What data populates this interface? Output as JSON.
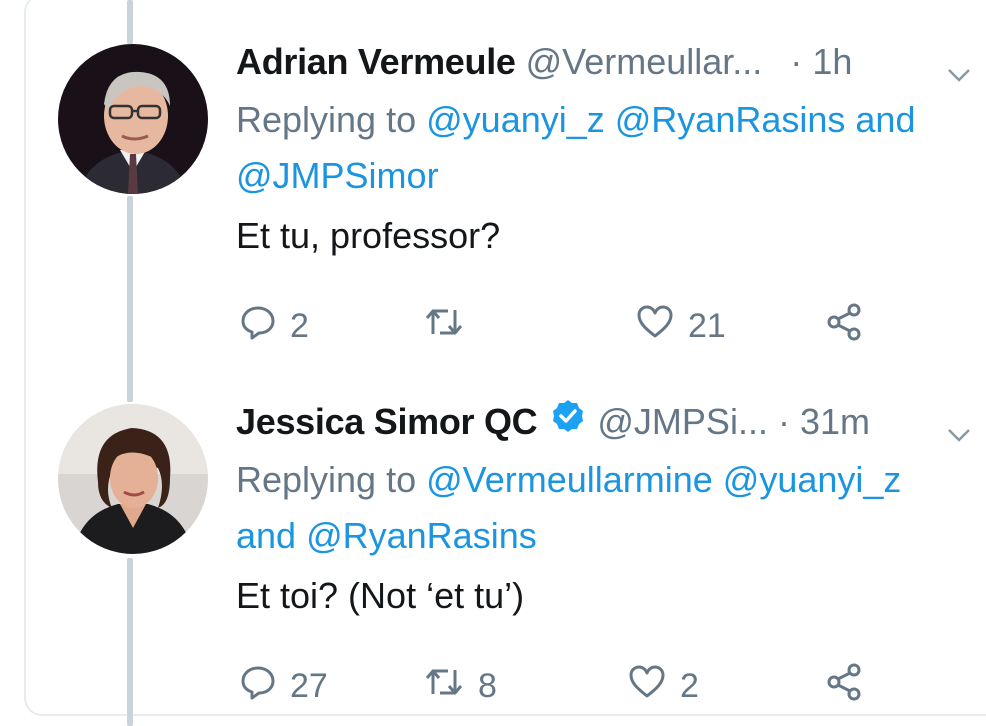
{
  "tweets": [
    {
      "name": "Adrian Vermeule",
      "handle": "@Vermeullar...",
      "separator": "·",
      "time": "1h",
      "verified": false,
      "replying_prefix": "Replying to",
      "mentions_line1": "@yuanyi_z @RyanRasins",
      "and_word": "and",
      "mentions_line2": "@JMPSimor",
      "text": "Et tu, professor?",
      "replies": "2",
      "retweets": "",
      "likes": "21"
    },
    {
      "name": "Jessica Simor QC",
      "handle": "@JMPSi...",
      "separator": "·",
      "time": "31m",
      "verified": true,
      "replying_prefix": "Replying to",
      "mentions_line1": "@Vermeullarmine @yuanyi_z",
      "and_word": "and",
      "mentions_line2": "@RyanRasins",
      "text": "Et toi? (Not ‘et tu’)",
      "replies": "27",
      "retweets": "8",
      "likes": "2"
    }
  ],
  "colors": {
    "text": "#14171a",
    "secondary": "#657786",
    "link": "#1b95e0",
    "verified": "#1da1f2",
    "thread_line": "#c9d3da"
  },
  "icons": [
    "reply-icon",
    "retweet-icon",
    "like-icon",
    "share-icon",
    "chevron-down-icon",
    "verified-badge-icon"
  ]
}
